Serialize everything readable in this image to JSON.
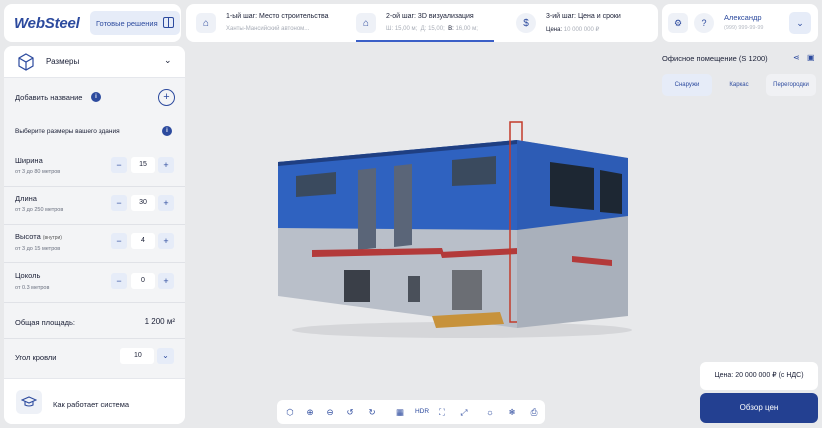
{
  "brand": {
    "logo": "WebSteel",
    "ready_solutions": "Готовые решения"
  },
  "steps": [
    {
      "title": "1-ый шаг: Место строительства",
      "subtitle": "Ханты-Мансийский автоном..."
    },
    {
      "title": "2-ой шаг: 3D визуализация",
      "w_label": "Ш:",
      "w_value": "15,00 м;",
      "l_label": "Д:",
      "l_value": "15,00;",
      "h_label": "В:",
      "h_value": "16,00 м;"
    },
    {
      "title": "3-ий шаг: Цена и сроки",
      "price_label": "Цена:",
      "price_value": "10 000 000 ₽"
    }
  ],
  "user": {
    "name": "Александр",
    "phone": "(999) 999-99-99"
  },
  "sidebar": {
    "title": "Размеры",
    "add_name": "Добавить название",
    "choose_sizes": "Выберите размеры вашего здания",
    "dimensions": [
      {
        "label": "Ширина",
        "note": "",
        "hint": "от 3 до 80 метров",
        "value": "15"
      },
      {
        "label": "Длина",
        "note": "",
        "hint": "от 3 до 250 метров",
        "value": "30"
      },
      {
        "label": "Высота",
        "note": "(внутри)",
        "hint": "от 3 до 15 метров",
        "value": "4"
      },
      {
        "label": "Цоколь",
        "note": "",
        "hint": "от 0.3 метров",
        "value": "0"
      }
    ],
    "area_label": "Общая площадь:",
    "area_value": "1 200 м²",
    "roof_angle_label": "Угол кровли",
    "roof_angle_value": "10",
    "how_it_works": "Как работает система"
  },
  "right": {
    "building_title": "Офисное помещение (S 1200)",
    "tabs": [
      "Снаружи",
      "Каркас",
      "Перегородки"
    ],
    "active_tab": "Снаружи",
    "price": "Цена:  20 000 000 ₽ (с НДС)",
    "review_button": "Обзор цен"
  },
  "toolbar": {
    "hdr": "HDR"
  },
  "colors": {
    "accent": "#2c4a9e",
    "primary_button": "#234091",
    "facade_blue": "#2f62c0"
  }
}
